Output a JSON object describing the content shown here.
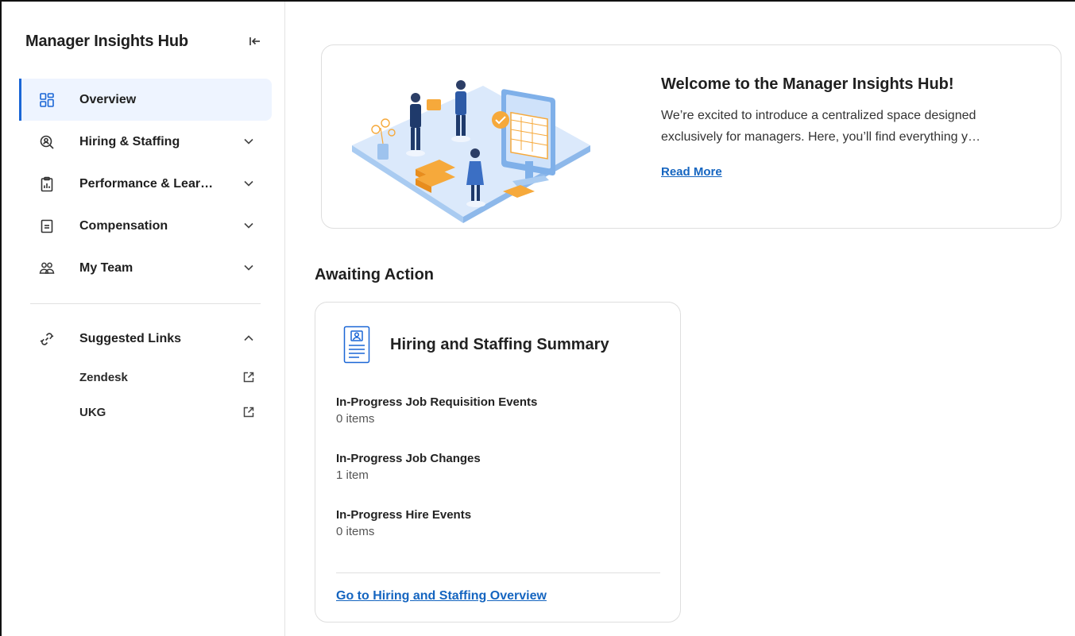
{
  "sidebar": {
    "title": "Manager Insights Hub",
    "nav": [
      {
        "label": "Overview",
        "icon": "dashboard-grid-icon",
        "active": true
      },
      {
        "label": "Hiring & Staffing",
        "icon": "search-person-icon",
        "expandable": true
      },
      {
        "label": "Performance & Lear…",
        "icon": "clipboard-chart-icon",
        "expandable": true
      },
      {
        "label": "Compensation",
        "icon": "document-lines-icon",
        "expandable": true
      },
      {
        "label": "My Team",
        "icon": "team-people-icon",
        "expandable": true
      }
    ],
    "suggested": {
      "label": "Suggested Links",
      "icon": "link-icon",
      "expanded": true,
      "links": [
        {
          "label": "Zendesk"
        },
        {
          "label": "UKG"
        }
      ]
    }
  },
  "welcome": {
    "title": "Welcome to the Manager Insights Hub!",
    "body": "We’re excited to introduce a centralized space designed exclusively for managers. Here, you’ll find everything y…",
    "read_more": "Read More"
  },
  "awaiting": {
    "title": "Awaiting Action",
    "card": {
      "title": "Hiring and Staffing Summary",
      "items": [
        {
          "title": "In-Progress Job Requisition Events",
          "count": "0 items"
        },
        {
          "title": "In-Progress Job Changes",
          "count": "1 item"
        },
        {
          "title": "In-Progress Hire Events",
          "count": "0 items"
        }
      ],
      "link": "Go to Hiring and Staffing Overview"
    }
  },
  "colors": {
    "accent": "#1a66d6",
    "link": "#1565c0",
    "active_bg": "#eef4ff",
    "illustration_blue": "#9ec3ee",
    "illustration_orange": "#f6a93b"
  }
}
